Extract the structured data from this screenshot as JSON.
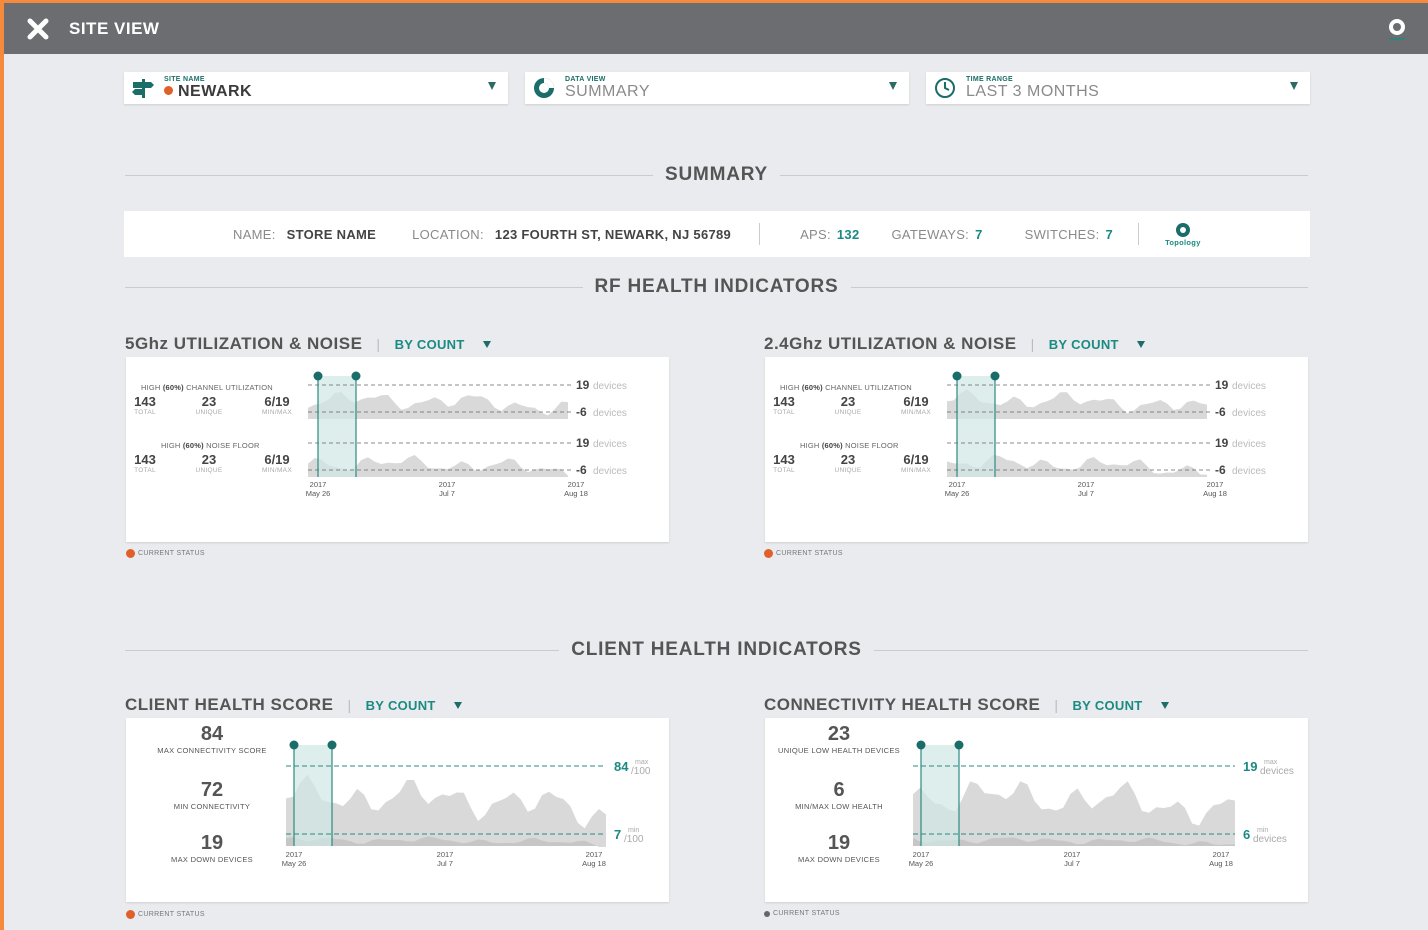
{
  "header": {
    "title": "SITE VIEW"
  },
  "selectors": {
    "site": {
      "label": "SITE NAME",
      "value": "NEWARK"
    },
    "data_view": {
      "label": "DATA VIEW",
      "value": "SUMMARY"
    },
    "time_range": {
      "label": "TIME RANGE",
      "value": "LAST 3 MONTHS"
    }
  },
  "summary": {
    "heading": "SUMMARY",
    "name_key": "NAME:",
    "name_val": "STORE NAME",
    "location_key": "LOCATION:",
    "location_val": "123 FOURTH ST, NEWARK, NJ 56789",
    "aps_key": "APS:",
    "aps_val": "132",
    "gateways_key": "GATEWAYS:",
    "gateways_val": "7",
    "switches_key": "SWITCHES:",
    "switches_val": "7",
    "topology": "Topology"
  },
  "rf": {
    "heading": "RF HEALTH INDICATORS",
    "panels": [
      {
        "title": "5Ghz UTILIZATION & NOISE",
        "by": "BY COUNT",
        "util": {
          "pre": "HIGH ",
          "pct": "(60%)",
          "post": " CHANNEL UTILIZATION",
          "total": "143",
          "unique": "23",
          "minmax": "6/19"
        },
        "noise": {
          "pre": "HIGH ",
          "pct": "(60%)",
          "post": " NOISE FLOOR",
          "total": "143",
          "unique": "23",
          "minmax": "6/19"
        },
        "status": "CURRENT STATUS"
      },
      {
        "title": "2.4Ghz UTILIZATION & NOISE",
        "by": "BY COUNT",
        "util": {
          "pre": "HIGH ",
          "pct": "(60%)",
          "post": " CHANNEL UTILIZATION",
          "total": "143",
          "unique": "23",
          "minmax": "6/19"
        },
        "noise": {
          "pre": "HIGH ",
          "pct": "(60%)",
          "post": " NOISE FLOOR",
          "total": "143",
          "unique": "23",
          "minmax": "6/19"
        },
        "status": "CURRENT STATUS"
      }
    ],
    "labels": {
      "total": "TOTAL",
      "unique": "UNIQUE",
      "minmax": "MIN/MAX",
      "max": "19",
      "min": "-6",
      "unit": "devices"
    }
  },
  "client": {
    "heading": "CLIENT HEALTH INDICATORS",
    "panels": [
      {
        "title": "CLIENT HEALTH SCORE",
        "by": "BY COUNT",
        "s1": {
          "n": "84",
          "u": "MAX CONNECTIVITY SCORE"
        },
        "s2": {
          "n": "72",
          "u": "MIN CONNECTIVITY"
        },
        "s3": {
          "n": "19",
          "u": "MAX DOWN DEVICES"
        },
        "max_val": "84",
        "max_top": "max",
        "max_bot": "/100",
        "min_val": "7",
        "min_top": "min",
        "min_bot": "/100",
        "status": "CURRENT STATUS"
      },
      {
        "title": "CONNECTIVITY HEALTH SCORE",
        "by": "BY COUNT",
        "s1": {
          "n": "23",
          "u": "UNIQUE LOW HEALTH DEVICES"
        },
        "s2": {
          "n": "6",
          "u": "MIN/MAX LOW HEALTH"
        },
        "s3": {
          "n": "19",
          "u": "MAX DOWN DEVICES"
        },
        "max_val": "19",
        "max_top": "max",
        "max_bot": "devices",
        "min_val": "6",
        "min_top": "min",
        "min_bot": "devices",
        "status": "CURRENT STATUS"
      }
    ]
  },
  "axis": {
    "year": "2017",
    "dates": [
      "May 26",
      "Jul 7",
      "Aug 18"
    ]
  },
  "colors": {
    "accent": "#1a8a82",
    "status": "#e0602a",
    "topbar": "#6b6d70",
    "area": "#d9d9d9"
  }
}
